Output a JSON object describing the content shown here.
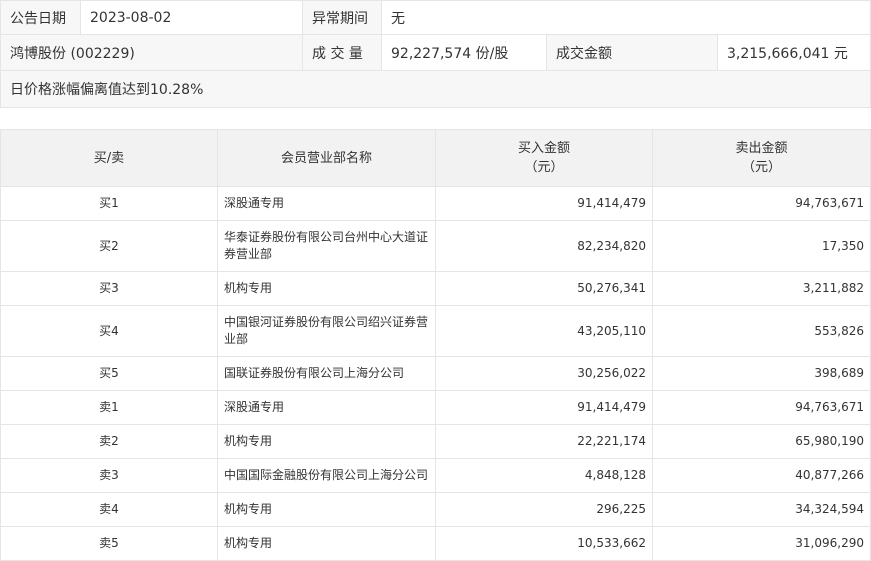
{
  "info": {
    "announce_date_label": "公告日期",
    "announce_date": "2023-08-02",
    "abnormal_period_label": "异常期间",
    "abnormal_period": "无",
    "stock": "鸿博股份 (002229)",
    "volume_label": "成 交 量",
    "volume": "92,227,574 份/股",
    "amount_label": "成交金额",
    "amount": "3,215,666,041 元",
    "reason": "日价格涨幅偏离值达到10.28%"
  },
  "detail": {
    "headers": {
      "side": "买/卖",
      "name": "会员营业部名称",
      "buy_line1": "买入金额",
      "buy_line2": "（元）",
      "sell_line1": "卖出金额",
      "sell_line2": "（元）"
    },
    "rows": [
      {
        "side": "买1",
        "name": "深股通专用",
        "buy": "91,414,479",
        "sell": "94,763,671"
      },
      {
        "side": "买2",
        "name": "华泰证券股份有限公司台州中心大道证券营业部",
        "buy": "82,234,820",
        "sell": "17,350"
      },
      {
        "side": "买3",
        "name": "机构专用",
        "buy": "50,276,341",
        "sell": "3,211,882"
      },
      {
        "side": "买4",
        "name": "中国银河证券股份有限公司绍兴证券营业部",
        "buy": "43,205,110",
        "sell": "553,826"
      },
      {
        "side": "买5",
        "name": "国联证券股份有限公司上海分公司",
        "buy": "30,256,022",
        "sell": "398,689"
      },
      {
        "side": "卖1",
        "name": "深股通专用",
        "buy": "91,414,479",
        "sell": "94,763,671"
      },
      {
        "side": "卖2",
        "name": "机构专用",
        "buy": "22,221,174",
        "sell": "65,980,190"
      },
      {
        "side": "卖3",
        "name": "中国国际金融股份有限公司上海分公司",
        "buy": "4,848,128",
        "sell": "40,877,266"
      },
      {
        "side": "卖4",
        "name": "机构专用",
        "buy": "296,225",
        "sell": "34,324,594"
      },
      {
        "side": "卖5",
        "name": "机构专用",
        "buy": "10,533,662",
        "sell": "31,096,290"
      }
    ]
  }
}
